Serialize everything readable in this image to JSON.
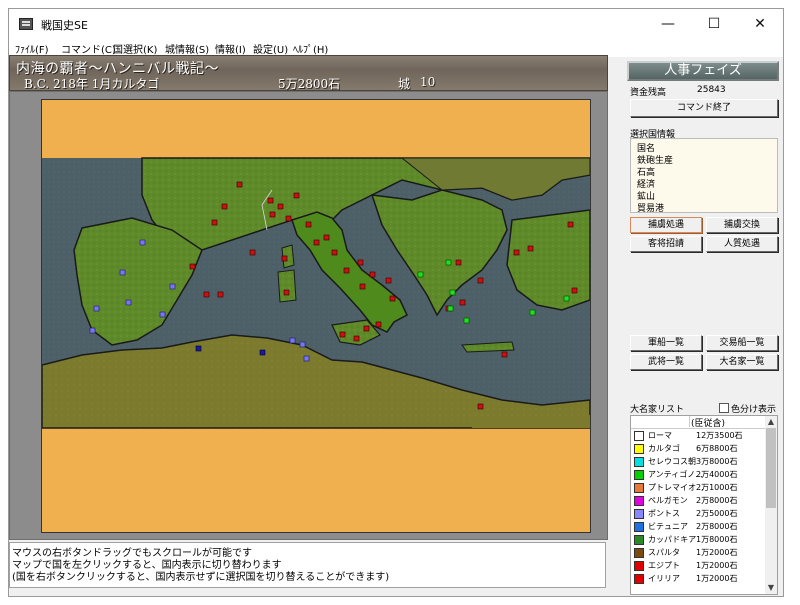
{
  "window": {
    "title": "戦国史SE",
    "minimize": "—",
    "maximize": "☐",
    "close": "✕"
  },
  "menu": [
    "ﾌｧｲﾙ(F)",
    "コマンド(C)",
    "国選択(K)",
    "城情報(S)",
    "情報(I)",
    "設定(U)",
    "ﾍﾙﾌﾟ(H)"
  ],
  "scenario": {
    "name": "内海の覇者〜ハンニバル戦記〜",
    "date": "B.C. 218年 1月カルタゴ",
    "koku": "5万2800石",
    "castle_label": "城",
    "castle_count": "10"
  },
  "panel": {
    "phase": "人事フェイズ",
    "funds_label": "資金残高",
    "funds_value": "25843",
    "command_end": "コマンド終了",
    "info_label": "選択国情報",
    "info_rows": [
      "国名",
      "鉄砲生産",
      "石高",
      "経済",
      "鉱山",
      "貿易港"
    ],
    "btn_capture": "捕虜処遇",
    "btn_exchange": "捕虜交換",
    "btn_guest": "客将招請",
    "btn_hostage": "人質処遇",
    "btn_army_ships": "軍船一覧",
    "btn_trade_ships": "交易船一覧",
    "btn_generals": "武将一覧",
    "btn_daimyo": "大名家一覧",
    "daimyo_list_label": "大名家リスト",
    "color_display_label": "色分け表示",
    "list_header": "(臣従含)"
  },
  "daimyo_list": [
    {
      "name": "ローマ",
      "koku": "12万3500石",
      "color": "#ffffff"
    },
    {
      "name": "カルタゴ",
      "koku": "6万8800石",
      "color": "#ffff00"
    },
    {
      "name": "セレウコス朝",
      "koku": "3万8000石",
      "color": "#00e0e0"
    },
    {
      "name": "アンティゴノ...",
      "koku": "2万4000石",
      "color": "#00d000"
    },
    {
      "name": "プトレマイオ...",
      "koku": "2万1000石",
      "color": "#e87838"
    },
    {
      "name": "ペルガモン",
      "koku": "2万8000石",
      "color": "#e000e0"
    },
    {
      "name": "ポントス",
      "koku": "2万5000石",
      "color": "#8888ff"
    },
    {
      "name": "ビテュニア",
      "koku": "2万8000石",
      "color": "#2070e0"
    },
    {
      "name": "カッパドキア",
      "koku": "1万8000石",
      "color": "#2a8a2a"
    },
    {
      "name": "スパルタ",
      "koku": "1万2000石",
      "color": "#7a4a10"
    },
    {
      "name": "エジプト",
      "koku": "1万2000石",
      "color": "#e00000"
    },
    {
      "name": "イリリア",
      "koku": "1万2000石",
      "color": "#e00000"
    }
  ],
  "status": {
    "line1": "マウスの右ボタンドラッグでもスクロールが可能です",
    "line2": "マップで国を左クリックすると、国内表示に切り替わります",
    "line3": "(国を右ボタンクリックすると、国内表示せずに選択国を切り替えることができます)"
  },
  "colors": {
    "sea": "#4d6068",
    "land": "#5f8a2a",
    "italy": "#4f8a1c",
    "africa": "#7c7a2c",
    "border_band": "#f0b050",
    "red_castle": "#cc1111",
    "blue_castle": "#7777ee",
    "dark_blue_castle": "#1a1a9a",
    "green_castle": "#22dd22"
  },
  "icons": {
    "app": "app-icon",
    "cursor": "arrow-cursor-icon",
    "scroll_up": "scroll-up-icon",
    "scroll_down": "scroll-down-icon"
  }
}
